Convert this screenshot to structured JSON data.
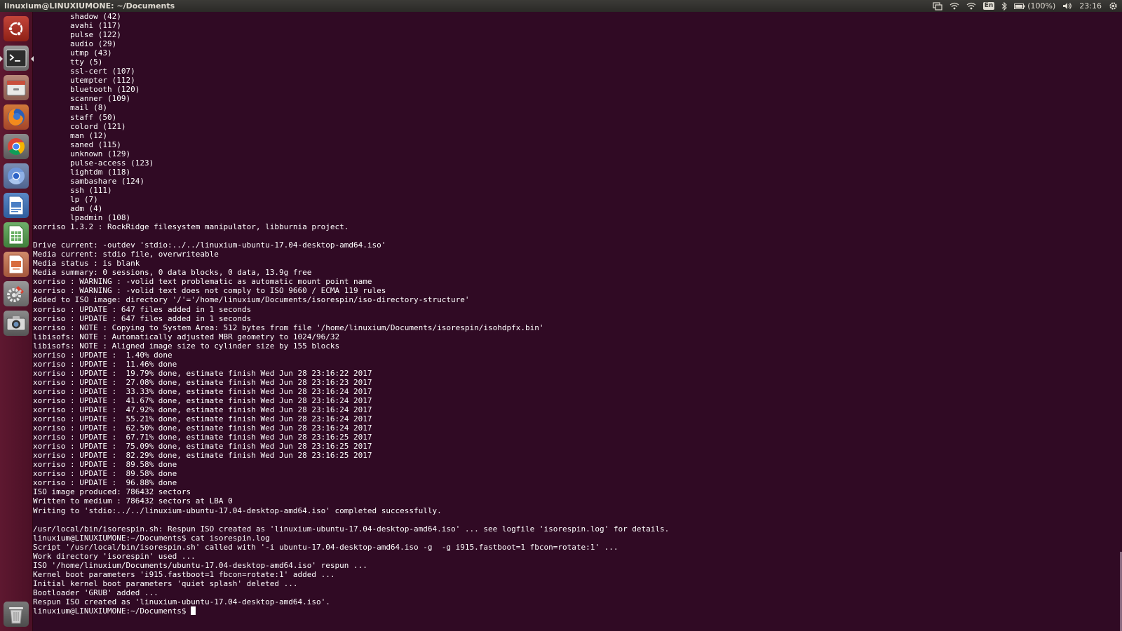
{
  "top_panel": {
    "title": "linuxium@LINUXIUMONE: ~/Documents",
    "keyboard_layout": "En",
    "battery_text": "(100%)",
    "clock": "23:16"
  },
  "launcher": {
    "items": [
      {
        "name": "ubuntu-dash-icon"
      },
      {
        "name": "terminal-icon"
      },
      {
        "name": "files-icon"
      },
      {
        "name": "firefox-icon"
      },
      {
        "name": "chrome-icon"
      },
      {
        "name": "chromium-icon"
      },
      {
        "name": "libreoffice-writer-icon"
      },
      {
        "name": "libreoffice-calc-icon"
      },
      {
        "name": "libreoffice-impress-icon"
      },
      {
        "name": "system-settings-icon"
      },
      {
        "name": "screenshot-icon"
      },
      {
        "name": "trash-icon"
      }
    ]
  },
  "terminal": {
    "lines": [
      "        shadow (42)",
      "        avahi (117)",
      "        pulse (122)",
      "        audio (29)",
      "        utmp (43)",
      "        tty (5)",
      "        ssl-cert (107)",
      "        utempter (112)",
      "        bluetooth (120)",
      "        scanner (109)",
      "        mail (8)",
      "        staff (50)",
      "        colord (121)",
      "        man (12)",
      "        saned (115)",
      "        unknown (129)",
      "        pulse-access (123)",
      "        lightdm (118)",
      "        sambashare (124)",
      "        ssh (111)",
      "        lp (7)",
      "        adm (4)",
      "        lpadmin (108)",
      "xorriso 1.3.2 : RockRidge filesystem manipulator, libburnia project.",
      "",
      "Drive current: -outdev 'stdio:../../linuxium-ubuntu-17.04-desktop-amd64.iso'",
      "Media current: stdio file, overwriteable",
      "Media status : is blank",
      "Media summary: 0 sessions, 0 data blocks, 0 data, 13.9g free",
      "xorriso : WARNING : -volid text problematic as automatic mount point name",
      "xorriso : WARNING : -volid text does not comply to ISO 9660 / ECMA 119 rules",
      "Added to ISO image: directory '/'='/home/linuxium/Documents/isorespin/iso-directory-structure'",
      "xorriso : UPDATE : 647 files added in 1 seconds",
      "xorriso : UPDATE : 647 files added in 1 seconds",
      "xorriso : NOTE : Copying to System Area: 512 bytes from file '/home/linuxium/Documents/isorespin/isohdpfx.bin'",
      "libisofs: NOTE : Automatically adjusted MBR geometry to 1024/96/32",
      "libisofs: NOTE : Aligned image size to cylinder size by 155 blocks",
      "xorriso : UPDATE :  1.40% done",
      "xorriso : UPDATE :  11.46% done",
      "xorriso : UPDATE :  19.79% done, estimate finish Wed Jun 28 23:16:22 2017",
      "xorriso : UPDATE :  27.08% done, estimate finish Wed Jun 28 23:16:23 2017",
      "xorriso : UPDATE :  33.33% done, estimate finish Wed Jun 28 23:16:24 2017",
      "xorriso : UPDATE :  41.67% done, estimate finish Wed Jun 28 23:16:24 2017",
      "xorriso : UPDATE :  47.92% done, estimate finish Wed Jun 28 23:16:24 2017",
      "xorriso : UPDATE :  55.21% done, estimate finish Wed Jun 28 23:16:24 2017",
      "xorriso : UPDATE :  62.50% done, estimate finish Wed Jun 28 23:16:24 2017",
      "xorriso : UPDATE :  67.71% done, estimate finish Wed Jun 28 23:16:25 2017",
      "xorriso : UPDATE :  75.09% done, estimate finish Wed Jun 28 23:16:25 2017",
      "xorriso : UPDATE :  82.29% done, estimate finish Wed Jun 28 23:16:25 2017",
      "xorriso : UPDATE :  89.58% done",
      "xorriso : UPDATE :  89.58% done",
      "xorriso : UPDATE :  96.88% done",
      "ISO image produced: 786432 sectors",
      "Written to medium : 786432 sectors at LBA 0",
      "Writing to 'stdio:../../linuxium-ubuntu-17.04-desktop-amd64.iso' completed successfully.",
      "",
      "/usr/local/bin/isorespin.sh: Respun ISO created as 'linuxium-ubuntu-17.04-desktop-amd64.iso' ... see logfile 'isorespin.log' for details.",
      "linuxium@LINUXIUMONE:~/Documents$ cat isorespin.log",
      "Script '/usr/local/bin/isorespin.sh' called with '-i ubuntu-17.04-desktop-amd64.iso -g  -g i915.fastboot=1 fbcon=rotate:1' ...",
      "Work directory 'isorespin' used ...",
      "ISO '/home/linuxium/Documents/ubuntu-17.04-desktop-amd64.iso' respun ...",
      "Kernel boot parameters 'i915.fastboot=1 fbcon=rotate:1' added ...",
      "Initial kernel boot parameters 'quiet splash' deleted ...",
      "Bootloader 'GRUB' added ...",
      "Respun ISO created as 'linuxium-ubuntu-17.04-desktop-amd64.iso'."
    ],
    "prompt": "linuxium@LINUXIUMONE:~/Documents$ "
  }
}
